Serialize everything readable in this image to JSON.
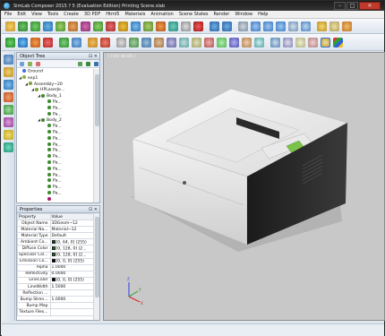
{
  "window": {
    "title": "SimLab Composer 2015 ? 5 (Evaluation Edition) Printing Scene.slab",
    "minimize": "–",
    "maximize": "□",
    "close": "✕"
  },
  "menu": [
    "File",
    "Edit",
    "View",
    "Tools",
    "Create",
    "3D PDF",
    "Html5",
    "Materials",
    "Animation",
    "Scene States",
    "Render",
    "Window",
    "Help"
  ],
  "object_tree": {
    "title": "Object Tree",
    "items": [
      {
        "label": "Ground",
        "depth": 0,
        "color": "#3f6fd8",
        "expander": ""
      },
      {
        "label": "exp1",
        "depth": 0,
        "color": "#8fae3a",
        "expander": "◢"
      },
      {
        "label": "Assembly~20",
        "depth": 1,
        "color": "#7da13a",
        "expander": "◢"
      },
      {
        "label": "HPLaserJe...",
        "depth": 2,
        "color": "#7da13a",
        "expander": "◢"
      },
      {
        "label": "Body_1",
        "depth": 3,
        "color": "#3c8a2a",
        "expander": "◢"
      },
      {
        "label": "Pa...",
        "depth": 4,
        "color": "#3c8a2a",
        "expander": ""
      },
      {
        "label": "Pa...",
        "depth": 4,
        "color": "#3c8a2a",
        "expander": ""
      },
      {
        "label": "Pa...",
        "depth": 4,
        "color": "#3c8a2a",
        "expander": ""
      },
      {
        "label": "Body_2",
        "depth": 3,
        "color": "#3c8a2a",
        "expander": "◢"
      },
      {
        "label": "Pa...",
        "depth": 4,
        "color": "#3c8a2a",
        "expander": ""
      },
      {
        "label": "Pa...",
        "depth": 4,
        "color": "#3c8a2a",
        "expander": ""
      },
      {
        "label": "Pa...",
        "depth": 4,
        "color": "#3c8a2a",
        "expander": ""
      },
      {
        "label": "Pa...",
        "depth": 4,
        "color": "#3c8a2a",
        "expander": ""
      },
      {
        "label": "Pa...",
        "depth": 4,
        "color": "#3c8a2a",
        "expander": ""
      },
      {
        "label": "Pa...",
        "depth": 4,
        "color": "#3c8a2a",
        "expander": ""
      },
      {
        "label": "Pa...",
        "depth": 4,
        "color": "#3c8a2a",
        "expander": ""
      },
      {
        "label": "Pa...",
        "depth": 4,
        "color": "#3c8a2a",
        "expander": ""
      },
      {
        "label": "Pa...",
        "depth": 4,
        "color": "#3c8a2a",
        "expander": ""
      },
      {
        "label": "Pa...",
        "depth": 4,
        "color": "#3c8a2a",
        "expander": ""
      },
      {
        "label": "Pa...",
        "depth": 4,
        "color": "#3c8a2a",
        "expander": ""
      },
      {
        "label": "Pa...",
        "depth": 4,
        "color": "#3c8a2a",
        "expander": ""
      },
      {
        "label": "",
        "depth": 4,
        "color": "#b0146a",
        "expander": ""
      }
    ]
  },
  "properties": {
    "title": "Properties",
    "header": [
      "Property",
      "Value"
    ],
    "rows": [
      {
        "name": "Object Name",
        "value": "3DGeom~12",
        "swatch": ""
      },
      {
        "name": "Material Na...",
        "value": "Material~12",
        "swatch": ""
      },
      {
        "name": "Material Type",
        "value": "Default",
        "swatch": ""
      },
      {
        "name": "Ambient Co...",
        "value": "[0, 64, 0] (255)",
        "swatch": "#0b4a0b"
      },
      {
        "name": "Diffuse Color",
        "value": "[0, 128, 0] (2...",
        "swatch": "#0a800a"
      },
      {
        "name": "Specular Col...",
        "value": "[0, 128, 0] (2...",
        "swatch": "#0a800a"
      },
      {
        "name": "Emission Co...",
        "value": "[0, 0, 0] (255)",
        "swatch": "#000000"
      },
      {
        "name": "Alpha",
        "value": "1.0000",
        "swatch": ""
      },
      {
        "name": "Reflectivity",
        "value": "0.0000",
        "swatch": ""
      },
      {
        "name": "LineColor",
        "value": "[0, 0, 0] (255)",
        "swatch": "#000000"
      },
      {
        "name": "LineWidth",
        "value": "1.5000",
        "swatch": ""
      },
      {
        "name": "Reflection ...",
        "value": "",
        "swatch": ""
      },
      {
        "name": "Bump Stren...",
        "value": "1.0000",
        "swatch": ""
      },
      {
        "name": "Bump Map",
        "value": "",
        "swatch": ""
      },
      {
        "name": "Texture Files...",
        "value": "",
        "swatch": ""
      }
    ]
  },
  "viewport": {
    "label": "[ FOV 30.00 ]",
    "axes": {
      "x": "X",
      "y": "Y",
      "z": "Z"
    }
  }
}
